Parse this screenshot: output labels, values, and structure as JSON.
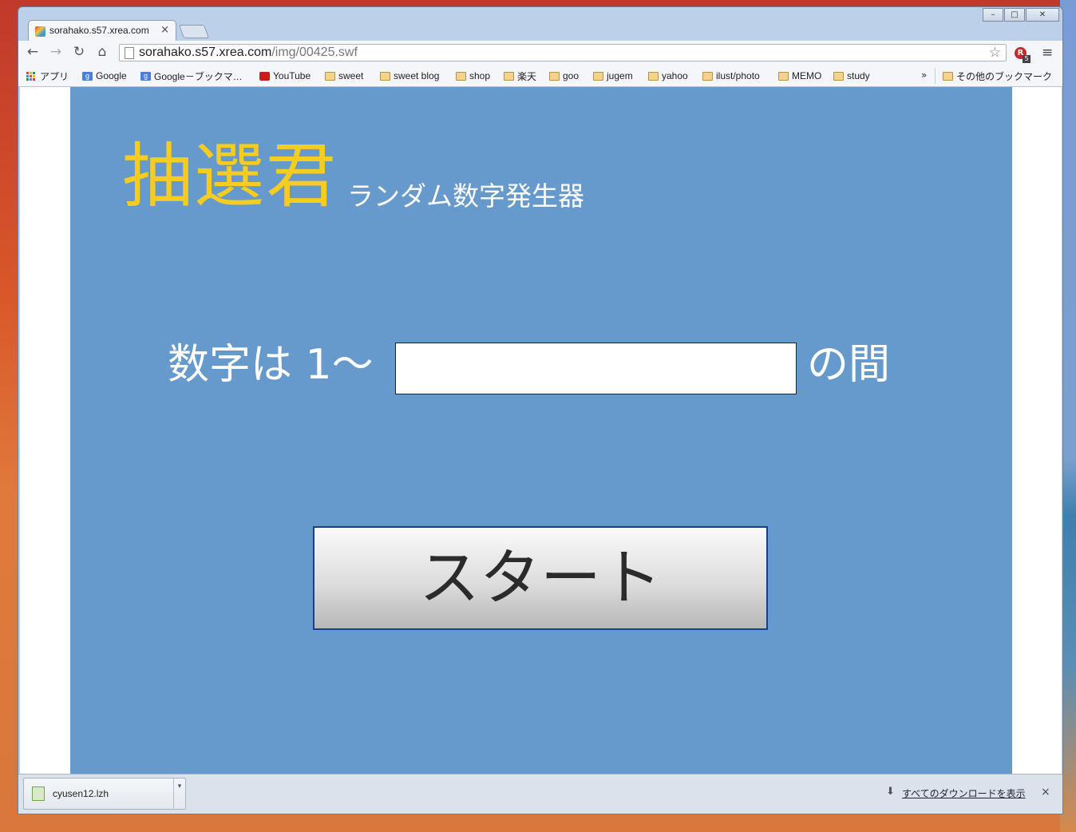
{
  "browser": {
    "tab_title": "sorahako.s57.xrea.com",
    "tab_close": "×",
    "url_host": "sorahako.s57.xrea.com",
    "url_path": "/img/00425.swf",
    "window_controls": {
      "minimize": "–",
      "maximize": "□",
      "close": "✕"
    },
    "nav": {
      "back": "←",
      "forward": "→",
      "reload": "↻",
      "home": "⌂",
      "star": "☆",
      "menu": "≡"
    },
    "extension": {
      "label": "R",
      "badge": "5"
    }
  },
  "bookmarks": {
    "items": [
      {
        "label": "アプリ",
        "icon": "apps-icon"
      },
      {
        "label": "Google",
        "icon": "google-icon"
      },
      {
        "label": "Google－ブックマ…",
        "icon": "google-icon"
      },
      {
        "label": "YouTube",
        "icon": "youtube-icon"
      },
      {
        "label": "sweet",
        "icon": "folder-icon"
      },
      {
        "label": "sweet blog",
        "icon": "folder-icon"
      },
      {
        "label": "shop",
        "icon": "folder-icon"
      },
      {
        "label": "楽天",
        "icon": "folder-icon"
      },
      {
        "label": "goo",
        "icon": "folder-icon"
      },
      {
        "label": "jugem",
        "icon": "folder-icon"
      },
      {
        "label": "yahoo",
        "icon": "folder-icon"
      },
      {
        "label": "ilust/photo",
        "icon": "folder-icon"
      },
      {
        "label": "MEMO",
        "icon": "folder-icon"
      },
      {
        "label": "study",
        "icon": "folder-icon"
      }
    ],
    "more": "»",
    "other": "その他のブックマーク"
  },
  "app": {
    "title": "抽選君",
    "subtitle": "ランダム数字発生器",
    "range_label": "数字は 1～",
    "range_input_value": "",
    "range_suffix": "の間",
    "start_label": "スタート",
    "colors": {
      "background": "#6699cc",
      "title": "#f5cc1f",
      "button_border": "#1a3f8a"
    }
  },
  "downloads": {
    "file_name": "cyusen12.lzh",
    "dropdown": "▾",
    "show_all": "すべてのダウンロードを表示",
    "close": "×"
  }
}
